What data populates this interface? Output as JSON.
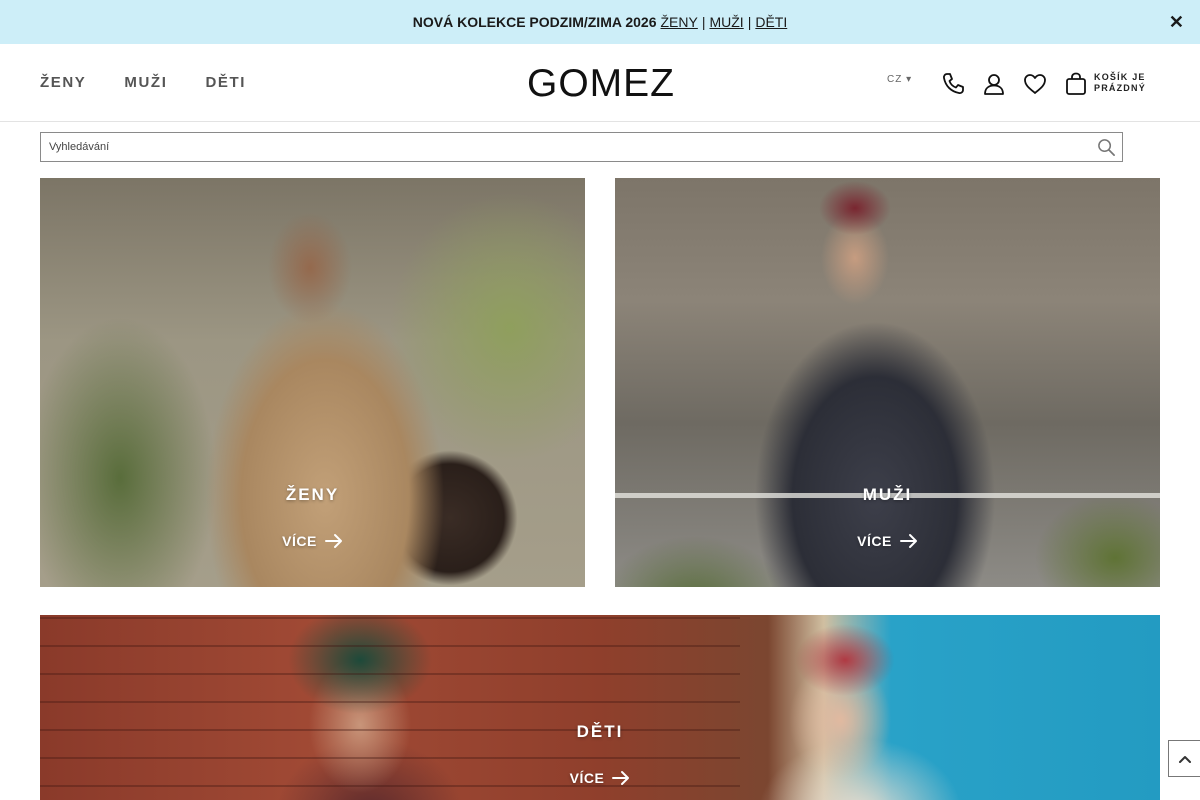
{
  "promo": {
    "lead": "NOVÁ KOLEKCE PODZIM/ZIMA 2026",
    "links": [
      "ŽENY",
      "MUŽI",
      "DĚTI"
    ],
    "separator": "|",
    "close_icon": "close-icon",
    "background": "#cdeef8"
  },
  "header": {
    "nav": [
      "ŽENY",
      "MUŽI",
      "DĚTI"
    ],
    "logo": "GOMEZ",
    "language": "CZ ▾",
    "icons": [
      "phone-icon",
      "user-icon",
      "heart-icon",
      "bag-icon"
    ],
    "cart_line1": "KOŠÍK JE",
    "cart_line2": "PRÁZDNÝ"
  },
  "search": {
    "placeholder": "Vyhledávání",
    "icon": "search-icon"
  },
  "tiles": [
    {
      "label": "ŽENY",
      "more": "VÍCE"
    },
    {
      "label": "MUŽI",
      "more": "VÍCE"
    },
    {
      "label": "DĚTI",
      "more": "VÍCE"
    }
  ],
  "back_to_top": {
    "icon": "chevron-up-icon"
  }
}
